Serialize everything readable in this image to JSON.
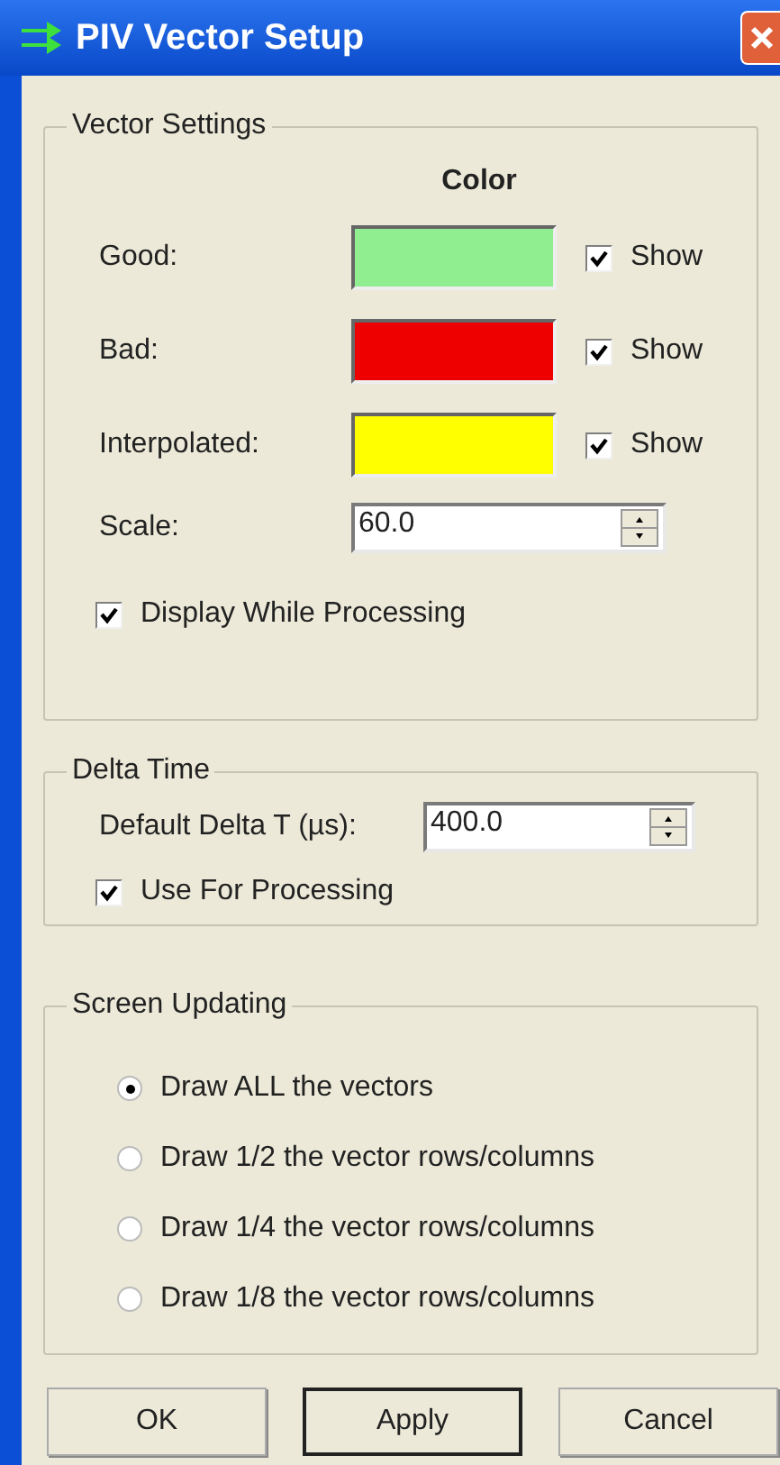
{
  "window": {
    "title": "PIV Vector Setup"
  },
  "vector_settings": {
    "title": "Vector Settings",
    "color_heading": "Color",
    "rows": [
      {
        "label": "Good:",
        "color": "#90ee90",
        "show_label": "Show",
        "checked": true
      },
      {
        "label": "Bad:",
        "color": "#ee0000",
        "show_label": "Show",
        "checked": true
      },
      {
        "label": "Interpolated:",
        "color": "#ffff00",
        "show_label": "Show",
        "checked": true
      }
    ],
    "scale": {
      "label": "Scale:",
      "value": "60.0"
    },
    "display_while_processing": {
      "label": "Display While Processing",
      "checked": true
    }
  },
  "delta_time": {
    "title": "Delta Time",
    "default": {
      "label": "Default Delta T (µs):",
      "value": "400.0"
    },
    "use_for_processing": {
      "label": "Use For Processing",
      "checked": true
    }
  },
  "screen_updating": {
    "title": "Screen Updating",
    "options": [
      {
        "label": "Draw ALL the vectors",
        "selected": true
      },
      {
        "label": "Draw 1/2 the vector rows/columns",
        "selected": false
      },
      {
        "label": "Draw 1/4 the vector rows/columns",
        "selected": false
      },
      {
        "label": "Draw 1/8 the vector rows/columns",
        "selected": false
      }
    ]
  },
  "buttons": [
    {
      "label": "OK",
      "default": false
    },
    {
      "label": "Apply",
      "default": true
    },
    {
      "label": "Cancel",
      "default": false
    }
  ]
}
